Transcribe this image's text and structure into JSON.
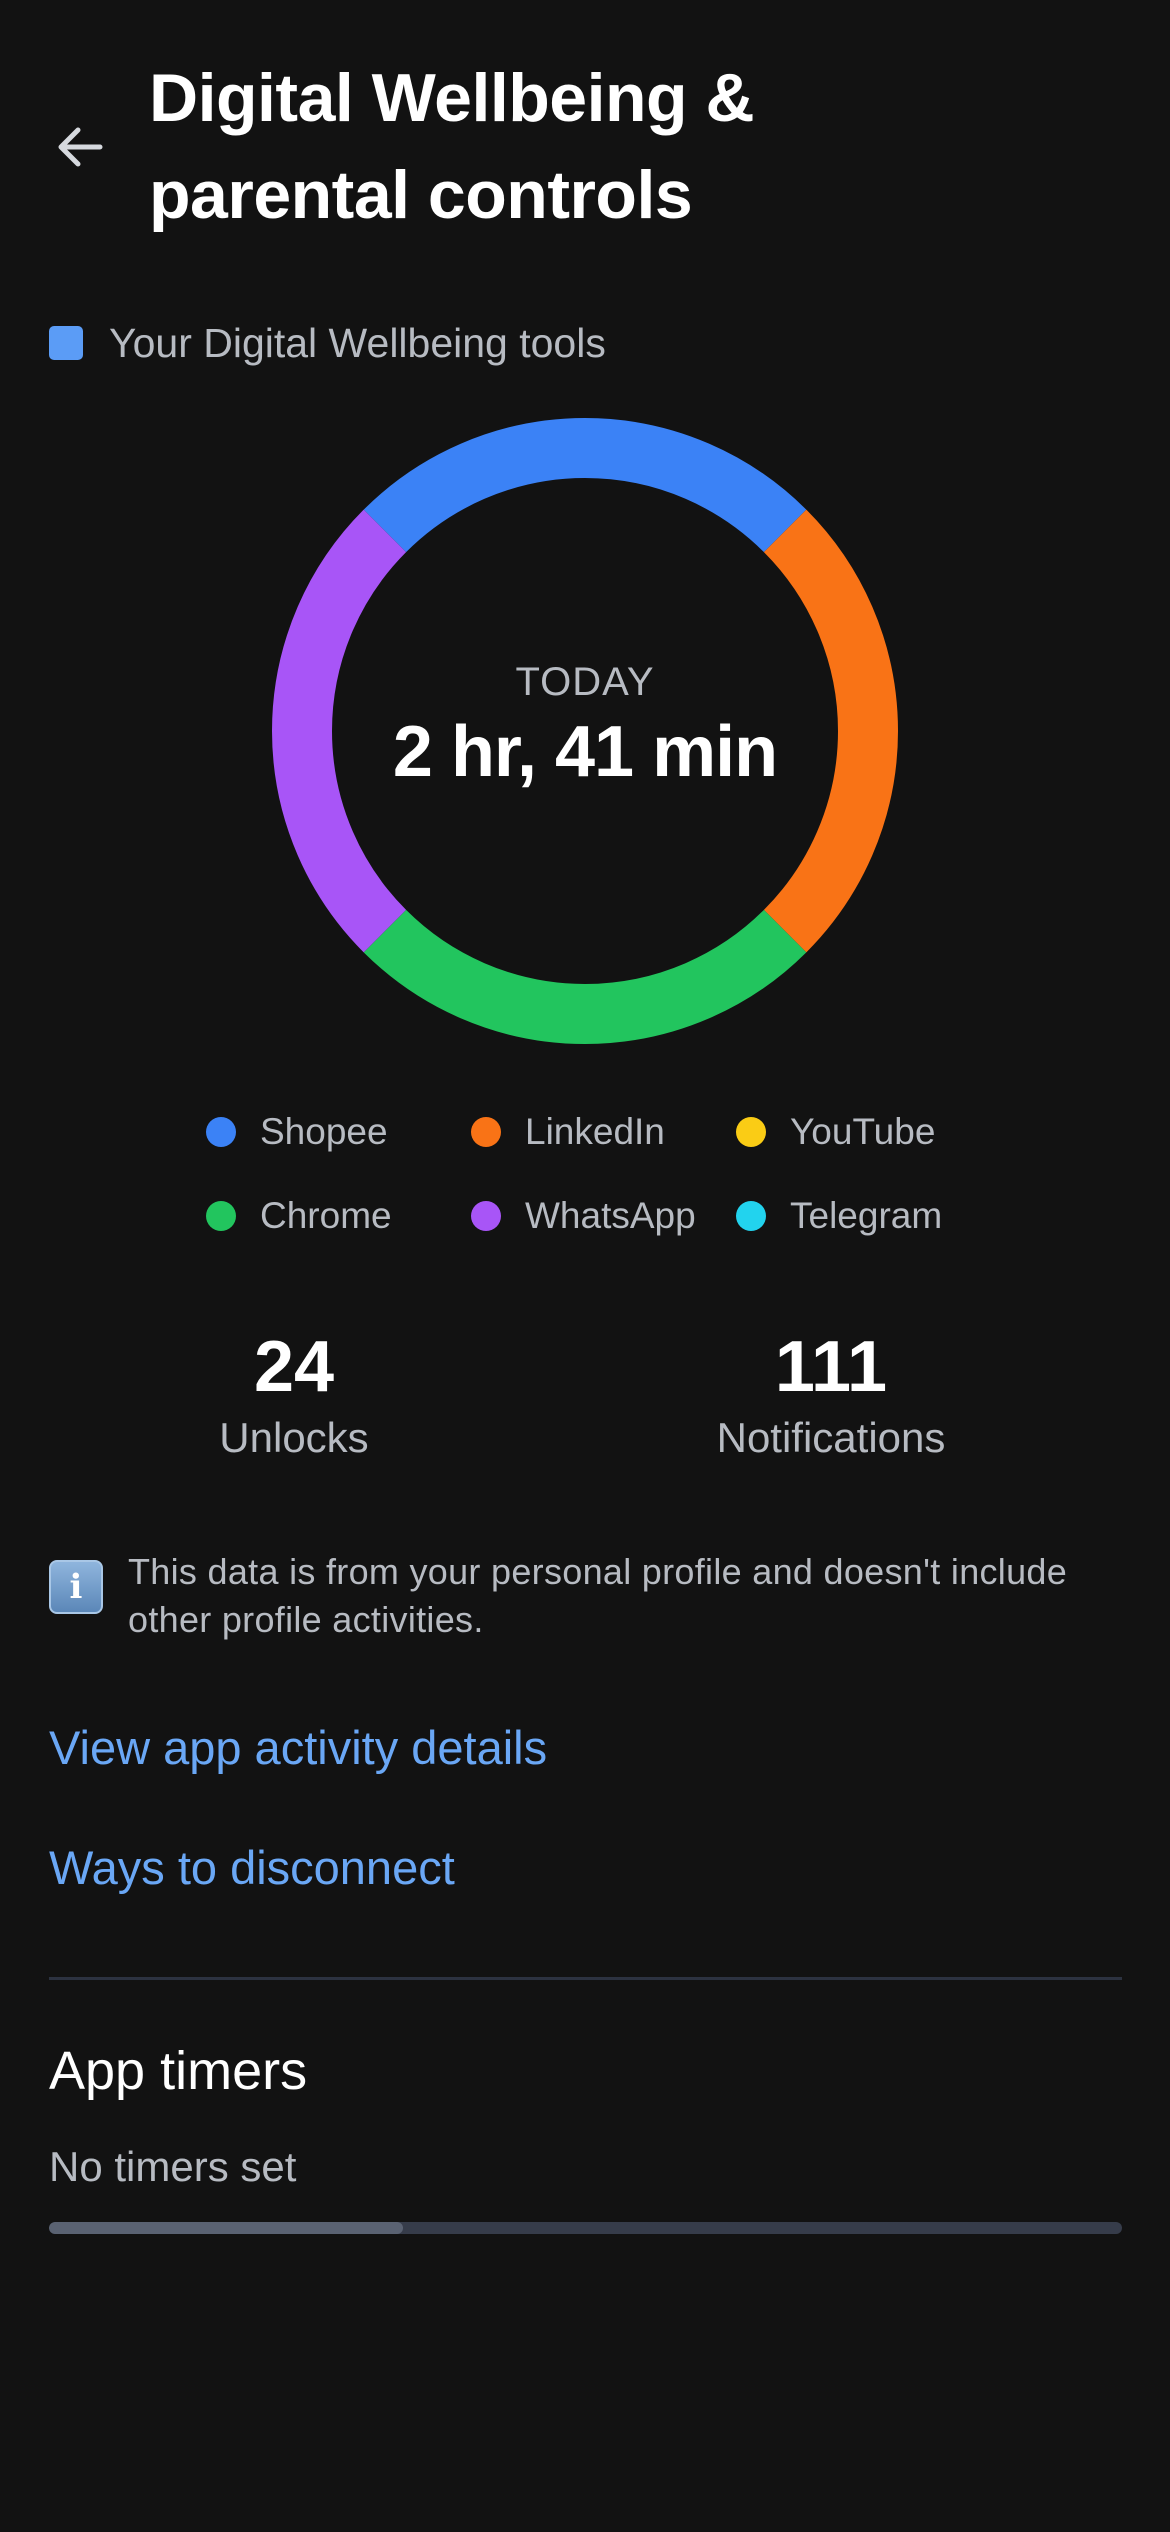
{
  "header": {
    "title_line1": "Digital Wellbeing &",
    "title_line2": "parental controls",
    "back_icon": "arrow-left-icon"
  },
  "tools_section": {
    "label": "Your Digital Wellbeing tools",
    "marker_color": "#5b9cf6"
  },
  "usage": {
    "period_label": "TODAY",
    "total_time": "2 hr, 41 min",
    "segment_shares": [
      {
        "app": "Shopee",
        "share": 0.25
      },
      {
        "app": "LinkedIn",
        "share": 0.25
      },
      {
        "app": "Chrome",
        "share": 0.25
      },
      {
        "app": "WhatsApp",
        "share": 0.25
      }
    ]
  },
  "legend": [
    {
      "name": "Shopee",
      "color": "#3b82f6"
    },
    {
      "name": "LinkedIn",
      "color": "#f97316"
    },
    {
      "name": "YouTube",
      "color": "#facc15"
    },
    {
      "name": "Chrome",
      "color": "#22c55e"
    },
    {
      "name": "WhatsApp",
      "color": "#a855f7"
    },
    {
      "name": "Telegram",
      "color": "#22d3ee"
    }
  ],
  "stats": {
    "unlocks": {
      "value": "24",
      "label": "Unlocks"
    },
    "notifications": {
      "value": "111",
      "label": "Notifications"
    }
  },
  "info": {
    "icon": "info-icon",
    "text": "This data is from your personal profile and doesn't include other profile activities."
  },
  "links": {
    "activity_details": "View app activity details",
    "disconnect": "Ways to disconnect"
  },
  "app_timers": {
    "title": "App timers",
    "subtitle": "No timers set",
    "progress": 0.33
  }
}
